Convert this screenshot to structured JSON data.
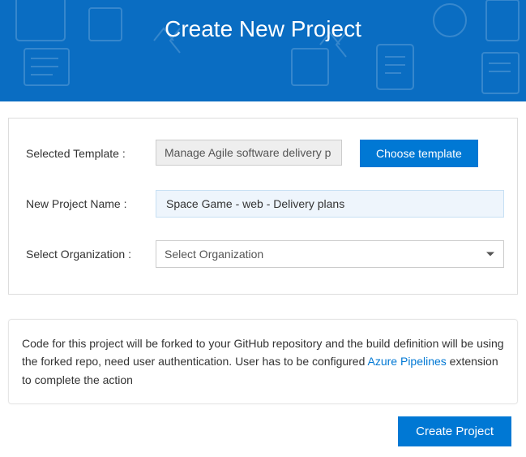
{
  "header": {
    "title": "Create New Project"
  },
  "form": {
    "template": {
      "label": "Selected Template :",
      "value": "Manage Agile software delivery p",
      "button": "Choose template"
    },
    "project_name": {
      "label": "New Project Name :",
      "value": "Space Game - web - Delivery plans"
    },
    "organization": {
      "label": "Select Organization :",
      "placeholder": "Select Organization"
    }
  },
  "info": {
    "text_before_link": "Code for this project will be forked to your GitHub repository and the build definition will be using the forked repo, need user authentication. User has to be configured ",
    "link_text": "Azure Pipelines",
    "text_after_link": " extension to complete the action"
  },
  "footer": {
    "create_button": "Create Project"
  }
}
